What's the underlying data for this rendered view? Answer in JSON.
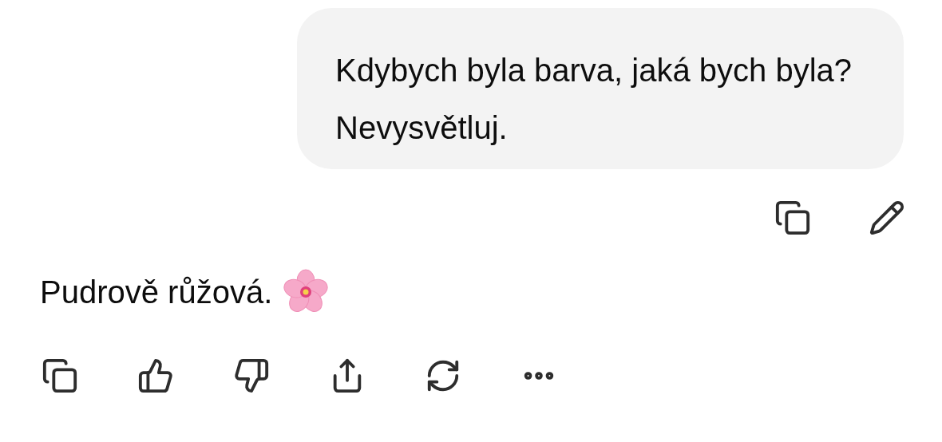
{
  "user_message": {
    "text": "Kdybych byla barva, jaká bych byla? Nevysvětluj."
  },
  "assistant_message": {
    "text": "Pudrově růžová."
  }
}
